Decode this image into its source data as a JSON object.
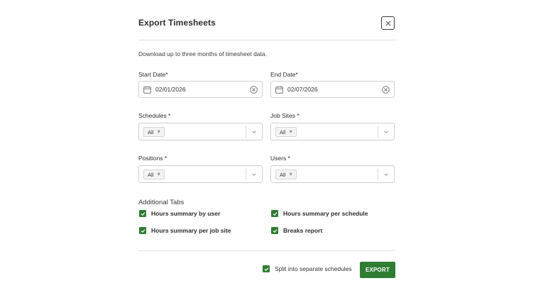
{
  "modal": {
    "title": "Export Timesheets",
    "description": "Download up to three months of timesheet data.",
    "close_icon": "close-icon"
  },
  "dates": {
    "start": {
      "label": "Start Date*",
      "value": "02/01/2026",
      "icon": "calendar-icon",
      "clear_icon": "clear-circle-icon"
    },
    "end": {
      "label": "End Date*",
      "value": "02/07/2026",
      "icon": "calendar-icon",
      "clear_icon": "clear-circle-icon"
    }
  },
  "filters": {
    "schedules": {
      "label": "Schedules *",
      "chip": "All",
      "chip_remove": "×"
    },
    "job_sites": {
      "label": "Job Sites *",
      "chip": "All",
      "chip_remove": "×"
    },
    "positions": {
      "label": "Positions *",
      "chip": "All",
      "chip_remove": "×"
    },
    "users": {
      "label": "Users *",
      "chip": "All",
      "chip_remove": "×"
    }
  },
  "additional_tabs": {
    "title": "Additional Tabs",
    "items": [
      {
        "label": "Hours summary by user",
        "checked": true
      },
      {
        "label": "Hours summary per schedule",
        "checked": true
      },
      {
        "label": "Hours summary per job site",
        "checked": true
      },
      {
        "label": "Breaks report",
        "checked": true
      }
    ]
  },
  "footer": {
    "split_label": "Split into separate schedules",
    "split_checked": true,
    "export_label": "EXPORT"
  },
  "colors": {
    "accent": "#2e7d32",
    "border": "#cfcfcf",
    "text": "#2d2d2d"
  }
}
